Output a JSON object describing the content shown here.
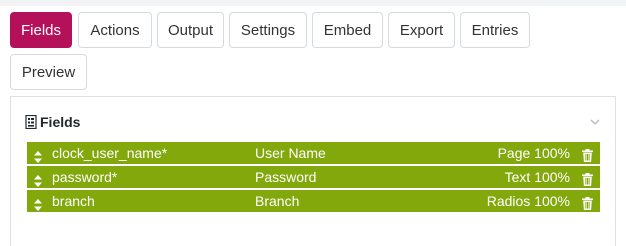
{
  "tabs": [
    {
      "label": "Fields",
      "active": true
    },
    {
      "label": "Actions",
      "active": false
    },
    {
      "label": "Output",
      "active": false
    },
    {
      "label": "Settings",
      "active": false
    },
    {
      "label": "Embed",
      "active": false
    },
    {
      "label": "Export",
      "active": false
    },
    {
      "label": "Entries",
      "active": false
    },
    {
      "label": "Preview",
      "active": false
    }
  ],
  "panel": {
    "title": "Fields",
    "icon": "form-icon",
    "collapse_icon": "chevron-down-icon"
  },
  "fields": [
    {
      "name": "clock_user_name*",
      "label": "User Name",
      "type": "Page 100%"
    },
    {
      "name": "password*",
      "label": "Password",
      "type": "Text 100%"
    },
    {
      "name": "branch",
      "label": "Branch",
      "type": "Radios 100%"
    }
  ],
  "colors": {
    "active_tab": "#b5115a",
    "field_row": "#82a80c"
  }
}
